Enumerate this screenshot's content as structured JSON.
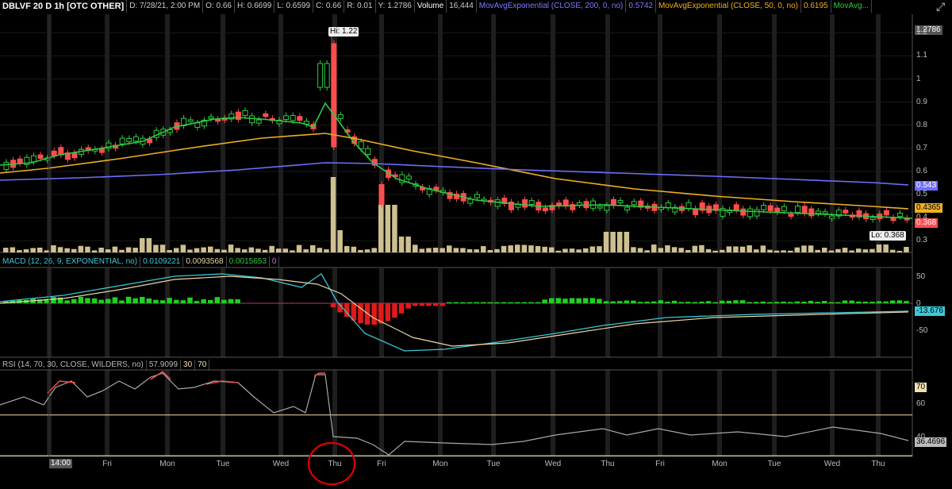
{
  "header": {
    "symbol": "DBLVF 20 D 1h [OTC OTHER]",
    "date": "D: 7/28/21, 2:00 PM",
    "open": "O: 0.66",
    "high": "H: 0.6699",
    "low": "L: 0.6599",
    "close": "C: 0.66",
    "range": "R: 0.01",
    "y": "Y: 1.2786",
    "volume_label": "Volume",
    "volume_value": "16,444",
    "ema200_label": "MovAvgExponential (CLOSE, 200, 0, no)",
    "ema200_value": "0.5742",
    "ema50_label": "MovAvgExponential (CLOSE, 50, 0, no)",
    "ema50_value": "0.6195",
    "ema20_label": "MovAvg..."
  },
  "macd_header": {
    "label": "MACD (12, 26, 9, EXPONENTIAL, no)",
    "value": "0.0109221",
    "avg": "0.0093568",
    "diff": "0.0015653",
    "zero": "0"
  },
  "rsi_header": {
    "label": "RSI (14, 70, 30, CLOSE, WILDERS, no)",
    "value": "57.9099",
    "oversold": "30",
    "overbought": "70"
  },
  "price_axis": {
    "ticks": [
      "1.2",
      "1.1",
      "1",
      "0.9",
      "0.8",
      "0.7",
      "0.6",
      "0.5",
      "0.4",
      "0.3"
    ],
    "top_value": "1.2786",
    "ema200_tag": "0.543",
    "ema50_tag": "0.4365",
    "last_tag": "0.368"
  },
  "annotations": {
    "hi": "Hi: 1.22",
    "lo": "Lo: 0.368"
  },
  "macd_axis": {
    "ticks": [
      "50",
      "0",
      "-50"
    ],
    "current": "-13.676"
  },
  "rsi_axis": {
    "ticks": [
      "60",
      "40"
    ],
    "level70": "70",
    "current": "36.4696"
  },
  "time_axis": {
    "first_label": "14:00",
    "days": [
      "Fri",
      "Mon",
      "Tue",
      "Wed",
      "Thu",
      "Fri",
      "Mon",
      "Tue",
      "Wed",
      "Thu",
      "Fri",
      "Mon",
      "Tue",
      "Wed",
      "Thu"
    ]
  },
  "colors": {
    "up": "#2ecc40",
    "down": "#ff4d4d",
    "ema20": "#2ecc40",
    "ema50": "#f0b020",
    "ema200": "#6f6fff",
    "volume": "#cfc090",
    "macd": "#3cc8d8",
    "signal": "#e8d8a8",
    "rsi": "#a8a8a8",
    "rsi_ob": "#ff4d4d",
    "circle": "#e00000"
  },
  "chart_data": {
    "type": "line",
    "title": "DBLVF 20 D 1h [OTC OTHER]",
    "x": [
      "Thu",
      "Fri",
      "Mon",
      "Tue",
      "Wed",
      "Thu",
      "Fri",
      "Mon",
      "Tue",
      "Wed",
      "Thu",
      "Fri",
      "Mon",
      "Tue",
      "Wed",
      "Thu"
    ],
    "series": [
      {
        "name": "MovAvgExponential (CLOSE, 20, 0, no)",
        "values": [
          0.63,
          0.71,
          0.8,
          0.87,
          0.84,
          0.92,
          0.62,
          0.52,
          0.47,
          0.44,
          0.43,
          0.42,
          0.41,
          0.4,
          0.39,
          0.38
        ]
      },
      {
        "name": "MovAvgExponential (CLOSE, 50, 0, no)",
        "values": [
          0.6,
          0.65,
          0.7,
          0.75,
          0.77,
          0.8,
          0.74,
          0.7,
          0.65,
          0.6,
          0.55,
          0.51,
          0.48,
          0.46,
          0.45,
          0.4365
        ]
      },
      {
        "name": "MovAvgExponential (CLOSE, 200, 0, no)",
        "values": [
          0.56,
          0.58,
          0.6,
          0.62,
          0.64,
          0.66,
          0.65,
          0.64,
          0.63,
          0.62,
          0.61,
          0.6,
          0.58,
          0.57,
          0.56,
          0.543
        ]
      },
      {
        "name": "RSI (14, 70, 30, CLOSE, WILDERS, no)",
        "values": [
          50,
          65,
          72,
          68,
          52,
          78,
          28,
          33,
          32,
          33,
          40,
          44,
          42,
          41,
          43,
          36.4696
        ]
      }
    ],
    "ylim": [
      0.25,
      1.28
    ],
    "hi": 1.22,
    "lo": 0.368,
    "last": 0.368
  }
}
